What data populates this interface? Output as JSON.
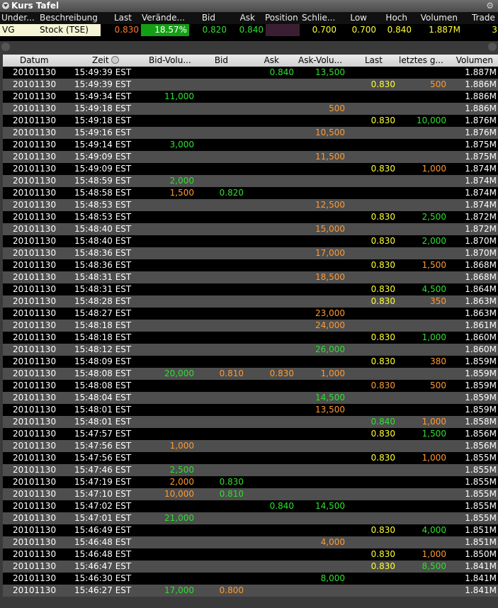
{
  "window": {
    "title": "Kurs Tafel"
  },
  "quote": {
    "headers": [
      "Under...",
      "Beschreibung",
      "Last",
      "Verände...",
      "Bid",
      "Ask",
      "Position",
      "Schlie...",
      "Low",
      "Hoch",
      "Volumen",
      "Trade"
    ],
    "row": {
      "symbol": "VG",
      "description": "Stock (TSE)",
      "last": "0.830",
      "change": "18.57%",
      "bid": "0.820",
      "ask": "0.840",
      "position": "",
      "close": "0.700",
      "low": "0.700",
      "high": "0.840",
      "volume": "1.887M",
      "trade": "3"
    }
  },
  "trades": {
    "headers": {
      "date": "Datum",
      "time": "Zeit",
      "bid_vol": "Bid-Volu...",
      "bid": "Bid",
      "ask": "Ask",
      "ask_vol": "Ask-Volu...",
      "last": "Last",
      "last_size": "letztes g...",
      "volume": "Volumen"
    },
    "rows": [
      {
        "date": "20101130",
        "time": "15:49:39 EST",
        "bv": "",
        "b": "",
        "a": "0.840",
        "av": "13,500",
        "avc": "#2ee02e",
        "l": "",
        "lc": "#ffff33",
        "ls": "",
        "lsc": "#ff9933",
        "v": "1.887M"
      },
      {
        "date": "20101130",
        "time": "15:49:39 EST",
        "bv": "",
        "b": "",
        "a": "",
        "av": "",
        "avc": "#2ee02e",
        "l": "0.830",
        "lc": "#ffff33",
        "ls": "500",
        "lsc": "#ff9933",
        "v": "1.886M"
      },
      {
        "date": "20101130",
        "time": "15:49:34 EST",
        "bv": "11,000",
        "b": "",
        "a": "",
        "av": "",
        "avc": "#2ee02e",
        "l": "",
        "lc": "#ffff33",
        "ls": "",
        "lsc": "#ff9933",
        "v": "1.886M"
      },
      {
        "date": "20101130",
        "time": "15:49:18 EST",
        "bv": "",
        "b": "",
        "a": "",
        "av": "500",
        "avc": "#ff9933",
        "l": "",
        "lc": "#ffff33",
        "ls": "",
        "lsc": "#ff9933",
        "v": "1.886M"
      },
      {
        "date": "20101130",
        "time": "15:49:18 EST",
        "bv": "",
        "b": "",
        "a": "",
        "av": "",
        "avc": "#2ee02e",
        "l": "0.830",
        "lc": "#ffff33",
        "ls": "10,000",
        "lsc": "#2ee02e",
        "v": "1.876M"
      },
      {
        "date": "20101130",
        "time": "15:49:16 EST",
        "bv": "",
        "b": "",
        "a": "",
        "av": "10,500",
        "avc": "#ff9933",
        "l": "",
        "lc": "#ffff33",
        "ls": "",
        "lsc": "#ff9933",
        "v": "1.876M"
      },
      {
        "date": "20101130",
        "time": "15:49:14 EST",
        "bv": "3,000",
        "b": "",
        "a": "",
        "av": "",
        "avc": "#2ee02e",
        "l": "",
        "lc": "#ffff33",
        "ls": "",
        "lsc": "#ff9933",
        "v": "1.875M"
      },
      {
        "date": "20101130",
        "time": "15:49:09 EST",
        "bv": "",
        "b": "",
        "a": "",
        "av": "11,500",
        "avc": "#ff9933",
        "l": "",
        "lc": "#ffff33",
        "ls": "",
        "lsc": "#ff9933",
        "v": "1.875M"
      },
      {
        "date": "20101130",
        "time": "15:49:09 EST",
        "bv": "",
        "b": "",
        "a": "",
        "av": "",
        "avc": "#2ee02e",
        "l": "0.830",
        "lc": "#ffff33",
        "ls": "1,000",
        "lsc": "#ff9933",
        "v": "1.874M"
      },
      {
        "date": "20101130",
        "time": "15:48:59 EST",
        "bv": "2,000",
        "b": "",
        "a": "",
        "av": "",
        "avc": "#2ee02e",
        "l": "",
        "lc": "#ffff33",
        "ls": "",
        "lsc": "#ff9933",
        "v": "1.874M"
      },
      {
        "date": "20101130",
        "time": "15:48:58 EST",
        "bv": "1,500",
        "bvc": "#ff9933",
        "b": "0.820",
        "a": "",
        "av": "",
        "avc": "#2ee02e",
        "l": "",
        "lc": "#ffff33",
        "ls": "",
        "lsc": "#ff9933",
        "v": "1.874M"
      },
      {
        "date": "20101130",
        "time": "15:48:53 EST",
        "bv": "",
        "b": "",
        "a": "",
        "av": "12,500",
        "avc": "#ff9933",
        "l": "",
        "lc": "#ffff33",
        "ls": "",
        "lsc": "#ff9933",
        "v": "1.874M"
      },
      {
        "date": "20101130",
        "time": "15:48:53 EST",
        "bv": "",
        "b": "",
        "a": "",
        "av": "",
        "avc": "#2ee02e",
        "l": "0.830",
        "lc": "#ffff33",
        "ls": "2,500",
        "lsc": "#2ee02e",
        "v": "1.872M"
      },
      {
        "date": "20101130",
        "time": "15:48:40 EST",
        "bv": "",
        "b": "",
        "a": "",
        "av": "15,000",
        "avc": "#ff9933",
        "l": "",
        "lc": "#ffff33",
        "ls": "",
        "lsc": "#ff9933",
        "v": "1.872M"
      },
      {
        "date": "20101130",
        "time": "15:48:40 EST",
        "bv": "",
        "b": "",
        "a": "",
        "av": "",
        "avc": "#2ee02e",
        "l": "0.830",
        "lc": "#ffff33",
        "ls": "2,000",
        "lsc": "#2ee02e",
        "v": "1.870M"
      },
      {
        "date": "20101130",
        "time": "15:48:36 EST",
        "bv": "",
        "b": "",
        "a": "",
        "av": "17,000",
        "avc": "#ff9933",
        "l": "",
        "lc": "#ffff33",
        "ls": "",
        "lsc": "#ff9933",
        "v": "1.870M"
      },
      {
        "date": "20101130",
        "time": "15:48:36 EST",
        "bv": "",
        "b": "",
        "a": "",
        "av": "",
        "avc": "#2ee02e",
        "l": "0.830",
        "lc": "#ffff33",
        "ls": "1,500",
        "lsc": "#ff9933",
        "v": "1.868M"
      },
      {
        "date": "20101130",
        "time": "15:48:31 EST",
        "bv": "",
        "b": "",
        "a": "",
        "av": "18,500",
        "avc": "#ff9933",
        "l": "",
        "lc": "#ffff33",
        "ls": "",
        "lsc": "#ff9933",
        "v": "1.868M"
      },
      {
        "date": "20101130",
        "time": "15:48:31 EST",
        "bv": "",
        "b": "",
        "a": "",
        "av": "",
        "avc": "#2ee02e",
        "l": "0.830",
        "lc": "#ffff33",
        "ls": "4,500",
        "lsc": "#2ee02e",
        "v": "1.864M"
      },
      {
        "date": "20101130",
        "time": "15:48:28 EST",
        "bv": "",
        "b": "",
        "a": "",
        "av": "",
        "avc": "#2ee02e",
        "l": "0.830",
        "lc": "#ffff33",
        "ls": "350",
        "lsc": "#ff9933",
        "v": "1.863M"
      },
      {
        "date": "20101130",
        "time": "15:48:27 EST",
        "bv": "",
        "b": "",
        "a": "",
        "av": "23,000",
        "avc": "#ff9933",
        "l": "",
        "lc": "#ffff33",
        "ls": "",
        "lsc": "#ff9933",
        "v": "1.863M"
      },
      {
        "date": "20101130",
        "time": "15:48:18 EST",
        "bv": "",
        "b": "",
        "a": "",
        "av": "24,000",
        "avc": "#ff9933",
        "l": "",
        "lc": "#ffff33",
        "ls": "",
        "lsc": "#ff9933",
        "v": "1.861M"
      },
      {
        "date": "20101130",
        "time": "15:48:18 EST",
        "bv": "",
        "b": "",
        "a": "",
        "av": "",
        "avc": "#2ee02e",
        "l": "0.830",
        "lc": "#ffff33",
        "ls": "1,000",
        "lsc": "#2ee02e",
        "v": "1.860M"
      },
      {
        "date": "20101130",
        "time": "15:48:12 EST",
        "bv": "",
        "b": "",
        "a": "",
        "av": "26,000",
        "avc": "#2ee02e",
        "l": "",
        "lc": "#ffff33",
        "ls": "",
        "lsc": "#ff9933",
        "v": "1.860M"
      },
      {
        "date": "20101130",
        "time": "15:48:09 EST",
        "bv": "",
        "b": "",
        "a": "",
        "av": "",
        "avc": "#2ee02e",
        "l": "0.830",
        "lc": "#ffff33",
        "ls": "380",
        "lsc": "#ff9933",
        "v": "1.859M"
      },
      {
        "date": "20101130",
        "time": "15:48:08 EST",
        "bv": "20,000",
        "b": "0.810",
        "bc": "#ff9933",
        "a": "0.830",
        "ac": "#ff9933",
        "av": "1,000",
        "avc": "#ff9933",
        "l": "",
        "lc": "#ffff33",
        "ls": "",
        "lsc": "#ff9933",
        "v": "1.859M"
      },
      {
        "date": "20101130",
        "time": "15:48:08 EST",
        "bv": "",
        "b": "",
        "a": "",
        "av": "",
        "avc": "#2ee02e",
        "l": "0.830",
        "lc": "#ff9933",
        "ls": "500",
        "lsc": "#ff9933",
        "v": "1.859M"
      },
      {
        "date": "20101130",
        "time": "15:48:04 EST",
        "bv": "",
        "b": "",
        "a": "",
        "av": "14,500",
        "avc": "#2ee02e",
        "l": "",
        "lc": "#ffff33",
        "ls": "",
        "lsc": "#ff9933",
        "v": "1.859M"
      },
      {
        "date": "20101130",
        "time": "15:48:01 EST",
        "bv": "",
        "b": "",
        "a": "",
        "av": "13,500",
        "avc": "#ff9933",
        "l": "",
        "lc": "#ffff33",
        "ls": "",
        "lsc": "#ff9933",
        "v": "1.859M"
      },
      {
        "date": "20101130",
        "time": "15:48:01 EST",
        "bv": "",
        "b": "",
        "a": "",
        "av": "",
        "avc": "#2ee02e",
        "l": "0.840",
        "lc": "#2ee02e",
        "ls": "1,000",
        "lsc": "#ff9933",
        "v": "1.858M"
      },
      {
        "date": "20101130",
        "time": "15:47:57 EST",
        "bv": "",
        "b": "",
        "a": "",
        "av": "",
        "avc": "#2ee02e",
        "l": "0.830",
        "lc": "#ffff33",
        "ls": "1,500",
        "lsc": "#2ee02e",
        "v": "1.856M"
      },
      {
        "date": "20101130",
        "time": "15:47:56 EST",
        "bv": "1,000",
        "bvc": "#ff9933",
        "b": "",
        "a": "",
        "av": "",
        "avc": "#2ee02e",
        "l": "",
        "lc": "#ffff33",
        "ls": "",
        "lsc": "#ff9933",
        "v": "1.856M"
      },
      {
        "date": "20101130",
        "time": "15:47:56 EST",
        "bv": "",
        "b": "",
        "a": "",
        "av": "",
        "avc": "#2ee02e",
        "l": "0.830",
        "lc": "#ffff33",
        "ls": "1,000",
        "lsc": "#ff9933",
        "v": "1.855M"
      },
      {
        "date": "20101130",
        "time": "15:47:46 EST",
        "bv": "2,500",
        "b": "",
        "a": "",
        "av": "",
        "avc": "#2ee02e",
        "l": "",
        "lc": "#ffff33",
        "ls": "",
        "lsc": "#ff9933",
        "v": "1.855M"
      },
      {
        "date": "20101130",
        "time": "15:47:19 EST",
        "bv": "2,000",
        "bvc": "#ff9933",
        "b": "0.830",
        "a": "",
        "av": "",
        "avc": "#2ee02e",
        "l": "",
        "lc": "#ffff33",
        "ls": "",
        "lsc": "#ff9933",
        "v": "1.855M"
      },
      {
        "date": "20101130",
        "time": "15:47:10 EST",
        "bv": "10,000",
        "bvc": "#ff9933",
        "b": "0.810",
        "a": "",
        "av": "",
        "avc": "#2ee02e",
        "l": "",
        "lc": "#ffff33",
        "ls": "",
        "lsc": "#ff9933",
        "v": "1.855M"
      },
      {
        "date": "20101130",
        "time": "15:47:02 EST",
        "bv": "",
        "b": "",
        "a": "0.840",
        "av": "14,500",
        "avc": "#2ee02e",
        "l": "",
        "lc": "#ffff33",
        "ls": "",
        "lsc": "#ff9933",
        "v": "1.855M"
      },
      {
        "date": "20101130",
        "time": "15:47:01 EST",
        "bv": "21,000",
        "b": "",
        "a": "",
        "av": "",
        "avc": "#2ee02e",
        "l": "",
        "lc": "#ffff33",
        "ls": "",
        "lsc": "#ff9933",
        "v": "1.855M"
      },
      {
        "date": "20101130",
        "time": "15:46:49 EST",
        "bv": "",
        "b": "",
        "a": "",
        "av": "",
        "avc": "#2ee02e",
        "l": "0.830",
        "lc": "#ffff33",
        "ls": "4,000",
        "lsc": "#2ee02e",
        "v": "1.851M"
      },
      {
        "date": "20101130",
        "time": "15:46:48 EST",
        "bv": "",
        "b": "",
        "a": "",
        "av": "4,000",
        "avc": "#ff9933",
        "l": "",
        "lc": "#ffff33",
        "ls": "",
        "lsc": "#ff9933",
        "v": "1.851M"
      },
      {
        "date": "20101130",
        "time": "15:46:48 EST",
        "bv": "",
        "b": "",
        "a": "",
        "av": "",
        "avc": "#2ee02e",
        "l": "0.830",
        "lc": "#ffff33",
        "ls": "1,000",
        "lsc": "#ff9933",
        "v": "1.850M"
      },
      {
        "date": "20101130",
        "time": "15:46:47 EST",
        "bv": "",
        "b": "",
        "a": "",
        "av": "",
        "avc": "#2ee02e",
        "l": "0.830",
        "lc": "#ffff33",
        "ls": "8,500",
        "lsc": "#2ee02e",
        "v": "1.841M"
      },
      {
        "date": "20101130",
        "time": "15:46:30 EST",
        "bv": "",
        "b": "",
        "a": "",
        "av": "8,000",
        "avc": "#2ee02e",
        "l": "",
        "lc": "#ffff33",
        "ls": "",
        "lsc": "#ff9933",
        "v": "1.841M"
      },
      {
        "date": "20101130",
        "time": "15:46:27 EST",
        "bv": "17,000",
        "b": "0.800",
        "bc": "#ff9933",
        "a": "",
        "av": "",
        "avc": "#2ee02e",
        "l": "",
        "lc": "#ffff33",
        "ls": "",
        "lsc": "#ff9933",
        "v": "1.841M"
      }
    ]
  }
}
